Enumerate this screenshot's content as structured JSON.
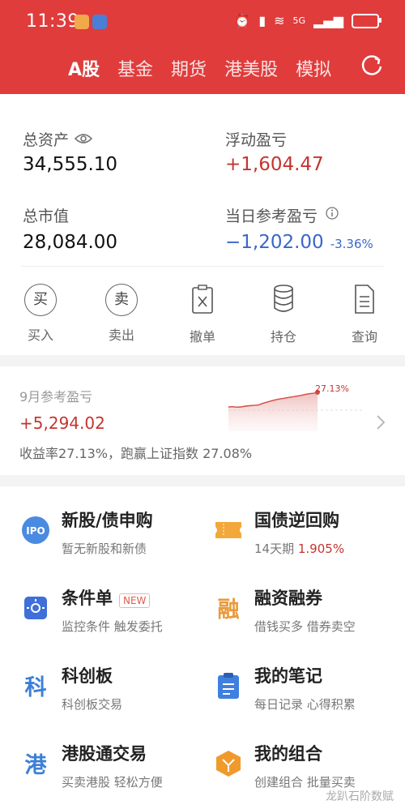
{
  "status": {
    "time": "11:39",
    "indicators": [
      "alarm-icon",
      "vibrate-icon",
      "wifi-icon",
      "5g-icon",
      "signal-icon",
      "battery-icon"
    ]
  },
  "tabs": [
    "A股",
    "基金",
    "期货",
    "港美股",
    "模拟"
  ],
  "active_tab": "A股",
  "summary": {
    "total_assets_label": "总资产",
    "total_assets_value": "34,555.10",
    "floating_pl_label": "浮动盈亏",
    "floating_pl_value": "+1,604.47",
    "market_value_label": "总市值",
    "market_value_value": "28,084.00",
    "day_pl_label": "当日参考盈亏",
    "day_pl_value": "−1,202.00",
    "day_pl_pct": "-3.36%"
  },
  "actions": [
    {
      "label": "买入",
      "glyph": "买"
    },
    {
      "label": "卖出",
      "glyph": "卖"
    },
    {
      "label": "撤单",
      "icon": "cancel-order-icon"
    },
    {
      "label": "持仓",
      "icon": "holdings-icon"
    },
    {
      "label": "查询",
      "icon": "query-icon"
    }
  ],
  "profit": {
    "label": "9月参考盈亏",
    "value": "+5,294.02",
    "note": "收益率27.13%，跑赢上证指数 27.08%",
    "chart_label": "27.13%"
  },
  "chart_data": {
    "type": "area",
    "series": [
      {
        "values": [
          0,
          0.5,
          -0.5,
          0,
          1.5,
          2.2,
          2.8,
          3.5,
          6.5,
          8.7,
          11.0,
          13.1,
          14.8,
          16.0,
          17.5,
          18.6,
          20.1,
          21.2,
          23.0,
          24.6,
          25.3,
          27.13
        ]
      }
    ],
    "callout": "27.13%"
  },
  "services": [
    {
      "title": "新股/债申购",
      "sub": "暂无新股和新债",
      "icon": "ipo-icon",
      "icon_text": "IPO"
    },
    {
      "title": "国债逆回购",
      "sub_prefix": "14天期",
      "sub_value": "1.905%",
      "icon": "ticket-icon"
    },
    {
      "title": "条件单",
      "badge": "NEW",
      "sub": "监控条件 触发委托",
      "icon": "condition-icon"
    },
    {
      "title": "融资融券",
      "sub": "借钱买多 借券卖空",
      "icon": "margin-icon",
      "icon_text": "融"
    },
    {
      "title": "科创板",
      "sub": "科创板交易",
      "icon": "star-market-icon",
      "icon_text": "科"
    },
    {
      "title": "我的笔记",
      "sub": "每日记录 心得积累",
      "icon": "notes-icon"
    },
    {
      "title": "港股通交易",
      "sub": "买卖港股 轻松方便",
      "icon": "hk-connect-icon",
      "icon_text": "港"
    },
    {
      "title": "我的组合",
      "sub": "创建组合 批量买卖",
      "icon": "portfolio-icon"
    }
  ],
  "watermark": "龙趴石阶数赋"
}
